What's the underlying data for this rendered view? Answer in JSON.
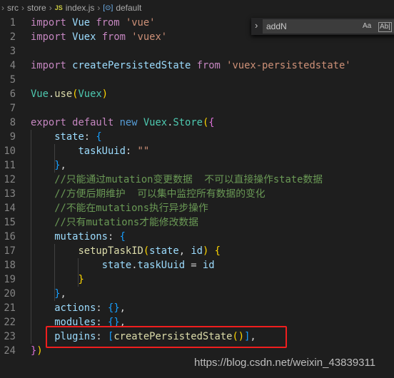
{
  "breadcrumb": {
    "items": [
      "src",
      "store",
      "index.js",
      "default"
    ],
    "file_icon": "JS",
    "symbol_icon": "[⊙]"
  },
  "find_widget": {
    "value": "addN",
    "match_case": "Aa",
    "whole_word": "Ab|"
  },
  "colors": {
    "k": "#c586c0",
    "b": "#569cd6",
    "v": "#9cdcfe",
    "c": "#4ec9b0",
    "f": "#dcdcaa",
    "s": "#ce9178",
    "m": "#6a9955",
    "p": "#d4d4d4",
    "y": "#ffd700",
    "o": "#da70d6",
    "l": "#179fff",
    "highlight": "#f01e1e"
  },
  "code": [
    [
      [
        "import",
        "k"
      ],
      [
        " "
      ],
      [
        "Vue",
        "v"
      ],
      [
        " "
      ],
      [
        "from",
        "k"
      ],
      [
        " "
      ],
      [
        "'vue'",
        "s"
      ]
    ],
    [
      [
        "import",
        "k"
      ],
      [
        " "
      ],
      [
        "Vuex",
        "v"
      ],
      [
        " "
      ],
      [
        "from",
        "k"
      ],
      [
        " "
      ],
      [
        "'vuex'",
        "s"
      ]
    ],
    [],
    [
      [
        "import",
        "k"
      ],
      [
        " "
      ],
      [
        "createPersistedState",
        "v"
      ],
      [
        " "
      ],
      [
        "from",
        "k"
      ],
      [
        " "
      ],
      [
        "'vuex-persistedstate'",
        "s"
      ]
    ],
    [],
    [
      [
        "Vue",
        "c"
      ],
      [
        ".",
        "p"
      ],
      [
        "use",
        "f"
      ],
      [
        "(",
        "y"
      ],
      [
        "Vuex",
        "c"
      ],
      [
        ")",
        "y"
      ]
    ],
    [],
    [
      [
        "export",
        "k"
      ],
      [
        " "
      ],
      [
        "default",
        "k"
      ],
      [
        " "
      ],
      [
        "new",
        "b"
      ],
      [
        " "
      ],
      [
        "Vuex",
        "c"
      ],
      [
        ".",
        "p"
      ],
      [
        "Store",
        "c"
      ],
      [
        "(",
        "y"
      ],
      [
        "{",
        "o"
      ]
    ],
    [
      [
        "    "
      ],
      [
        "state",
        "v"
      ],
      [
        ": ",
        "p"
      ],
      [
        "{",
        "l"
      ]
    ],
    [
      [
        "        "
      ],
      [
        "taskUuid",
        "v"
      ],
      [
        ": ",
        "p"
      ],
      [
        "\"\"",
        "s"
      ]
    ],
    [
      [
        "    "
      ],
      [
        "}",
        "l"
      ],
      [
        ",",
        "p"
      ]
    ],
    [
      [
        "    "
      ],
      [
        "//只能通过mutation变更数据  不可以直接操作state数据",
        "m"
      ]
    ],
    [
      [
        "    "
      ],
      [
        "//方便后期维护  可以集中监控所有数据的变化",
        "m"
      ]
    ],
    [
      [
        "    "
      ],
      [
        "//不能在mutations执行异步操作",
        "m"
      ]
    ],
    [
      [
        "    "
      ],
      [
        "//只有mutations才能修改数据",
        "m"
      ]
    ],
    [
      [
        "    "
      ],
      [
        "mutations",
        "v"
      ],
      [
        ": ",
        "p"
      ],
      [
        "{",
        "l"
      ]
    ],
    [
      [
        "        "
      ],
      [
        "setupTaskID",
        "f"
      ],
      [
        "(",
        "y"
      ],
      [
        "state",
        "v"
      ],
      [
        ", ",
        "p"
      ],
      [
        "id",
        "v"
      ],
      [
        ")",
        "y"
      ],
      [
        " "
      ],
      [
        "{",
        "y"
      ]
    ],
    [
      [
        "            "
      ],
      [
        "state",
        "v"
      ],
      [
        ".",
        "p"
      ],
      [
        "taskUuid",
        "v"
      ],
      [
        " = ",
        "p"
      ],
      [
        "id",
        "v"
      ]
    ],
    [
      [
        "        "
      ],
      [
        "}",
        "y"
      ]
    ],
    [
      [
        "    "
      ],
      [
        "}",
        "l"
      ],
      [
        ",",
        "p"
      ]
    ],
    [
      [
        "    "
      ],
      [
        "actions",
        "v"
      ],
      [
        ": ",
        "p"
      ],
      [
        "{}",
        "l"
      ],
      [
        ",",
        "p"
      ]
    ],
    [
      [
        "    "
      ],
      [
        "modules",
        "v"
      ],
      [
        ": ",
        "p"
      ],
      [
        "{}",
        "l"
      ],
      [
        ",",
        "p"
      ]
    ],
    [
      [
        "    "
      ],
      [
        "plugins",
        "v"
      ],
      [
        ": ",
        "p"
      ],
      [
        "[",
        "l"
      ],
      [
        "createPersistedState",
        "f"
      ],
      [
        "()",
        "y"
      ],
      [
        "]",
        "l"
      ],
      [
        ",",
        "p"
      ]
    ],
    [
      [
        "}",
        "o"
      ],
      [
        ")",
        "y"
      ]
    ]
  ],
  "watermark": "https://blog.csdn.net/weixin_43839311"
}
